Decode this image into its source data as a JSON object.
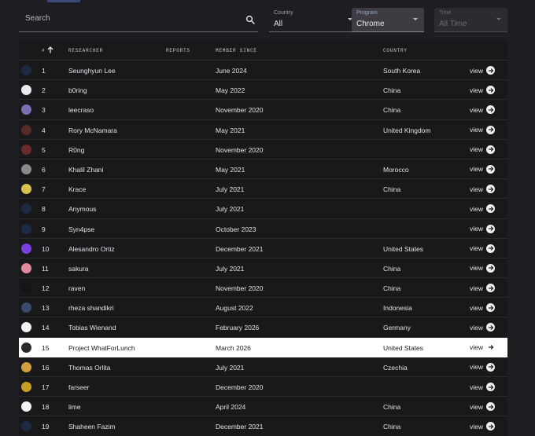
{
  "filters": {
    "search_placeholder": "Search",
    "country": {
      "label": "Country",
      "value": "All"
    },
    "program": {
      "label": "Program",
      "value": "Chrome"
    },
    "time": {
      "label": "Time",
      "value": "All Time"
    }
  },
  "table": {
    "headers": {
      "rank": "#",
      "researcher": "RESEARCHER",
      "reports": "REPORTS",
      "member_since": "MEMBER SINCE",
      "country": "COUNTRY"
    },
    "view_label": "view",
    "highlight_rank": 15,
    "rows": [
      {
        "rank": "1",
        "name": "Seunghyun Lee",
        "member_since": "June 2024",
        "country": "South Korea",
        "avatar_color": "#1d2a44"
      },
      {
        "rank": "2",
        "name": "b0ring",
        "member_since": "May 2022",
        "country": "China",
        "avatar_color": "#e9e9ee"
      },
      {
        "rank": "3",
        "name": "leecraso",
        "member_since": "November 2020",
        "country": "China",
        "avatar_color": "#7a6fb0"
      },
      {
        "rank": "4",
        "name": "Rory McNamara",
        "member_since": "May 2021",
        "country": "United Kingdom",
        "avatar_color": "#5a2a2a"
      },
      {
        "rank": "5",
        "name": "R0ng",
        "member_since": "November 2020",
        "country": "",
        "avatar_color": "#6a2a2a"
      },
      {
        "rank": "6",
        "name": "Khalil Zhani",
        "member_since": "May 2021",
        "country": "Morocco",
        "avatar_color": "#8a8a8a"
      },
      {
        "rank": "7",
        "name": "Krace",
        "member_since": "July 2021",
        "country": "China",
        "avatar_color": "#d6c24a"
      },
      {
        "rank": "8",
        "name": "Anymous",
        "member_since": "July 2021",
        "country": "",
        "avatar_color": "#1d2a44"
      },
      {
        "rank": "9",
        "name": "Syn4pse",
        "member_since": "October 2023",
        "country": "",
        "avatar_color": "#1d2a44"
      },
      {
        "rank": "10",
        "name": "Alesandro Ortiz",
        "member_since": "December 2021",
        "country": "United States",
        "avatar_color": "#7a3fe0"
      },
      {
        "rank": "11",
        "name": "sakura",
        "member_since": "July 2021",
        "country": "China",
        "avatar_color": "#e08aa0"
      },
      {
        "rank": "12",
        "name": "raven",
        "member_since": "November 2020",
        "country": "China",
        "avatar_color": "#141416"
      },
      {
        "rank": "13",
        "name": "rheza shandikri",
        "member_since": "August 2022",
        "country": "Indonesia",
        "avatar_color": "#3a4a6a"
      },
      {
        "rank": "14",
        "name": "Tobias Wienand",
        "member_since": "February 2026",
        "country": "Germany",
        "avatar_color": "#f2f2f2"
      },
      {
        "rank": "15",
        "name": "Project WhatForLunch",
        "member_since": "March 2026",
        "country": "United States",
        "avatar_color": "#2a2a2a"
      },
      {
        "rank": "16",
        "name": "Thomas Orlita",
        "member_since": "July 2021",
        "country": "Czechia",
        "avatar_color": "#d0a040"
      },
      {
        "rank": "17",
        "name": "farseer",
        "member_since": "December 2020",
        "country": "",
        "avatar_color": "#c8a020"
      },
      {
        "rank": "18",
        "name": "lime",
        "member_since": "April 2024",
        "country": "China",
        "avatar_color": "#f4f4f4"
      },
      {
        "rank": "19",
        "name": "Shaheen Fazim",
        "member_since": "December 2021",
        "country": "China",
        "avatar_color": "#1d2a44"
      }
    ]
  },
  "icons": {
    "search": "search-icon",
    "sort": "arrow-up-icon",
    "view": "arrow-right-circle-icon",
    "dropdown": "caret-down-icon"
  }
}
